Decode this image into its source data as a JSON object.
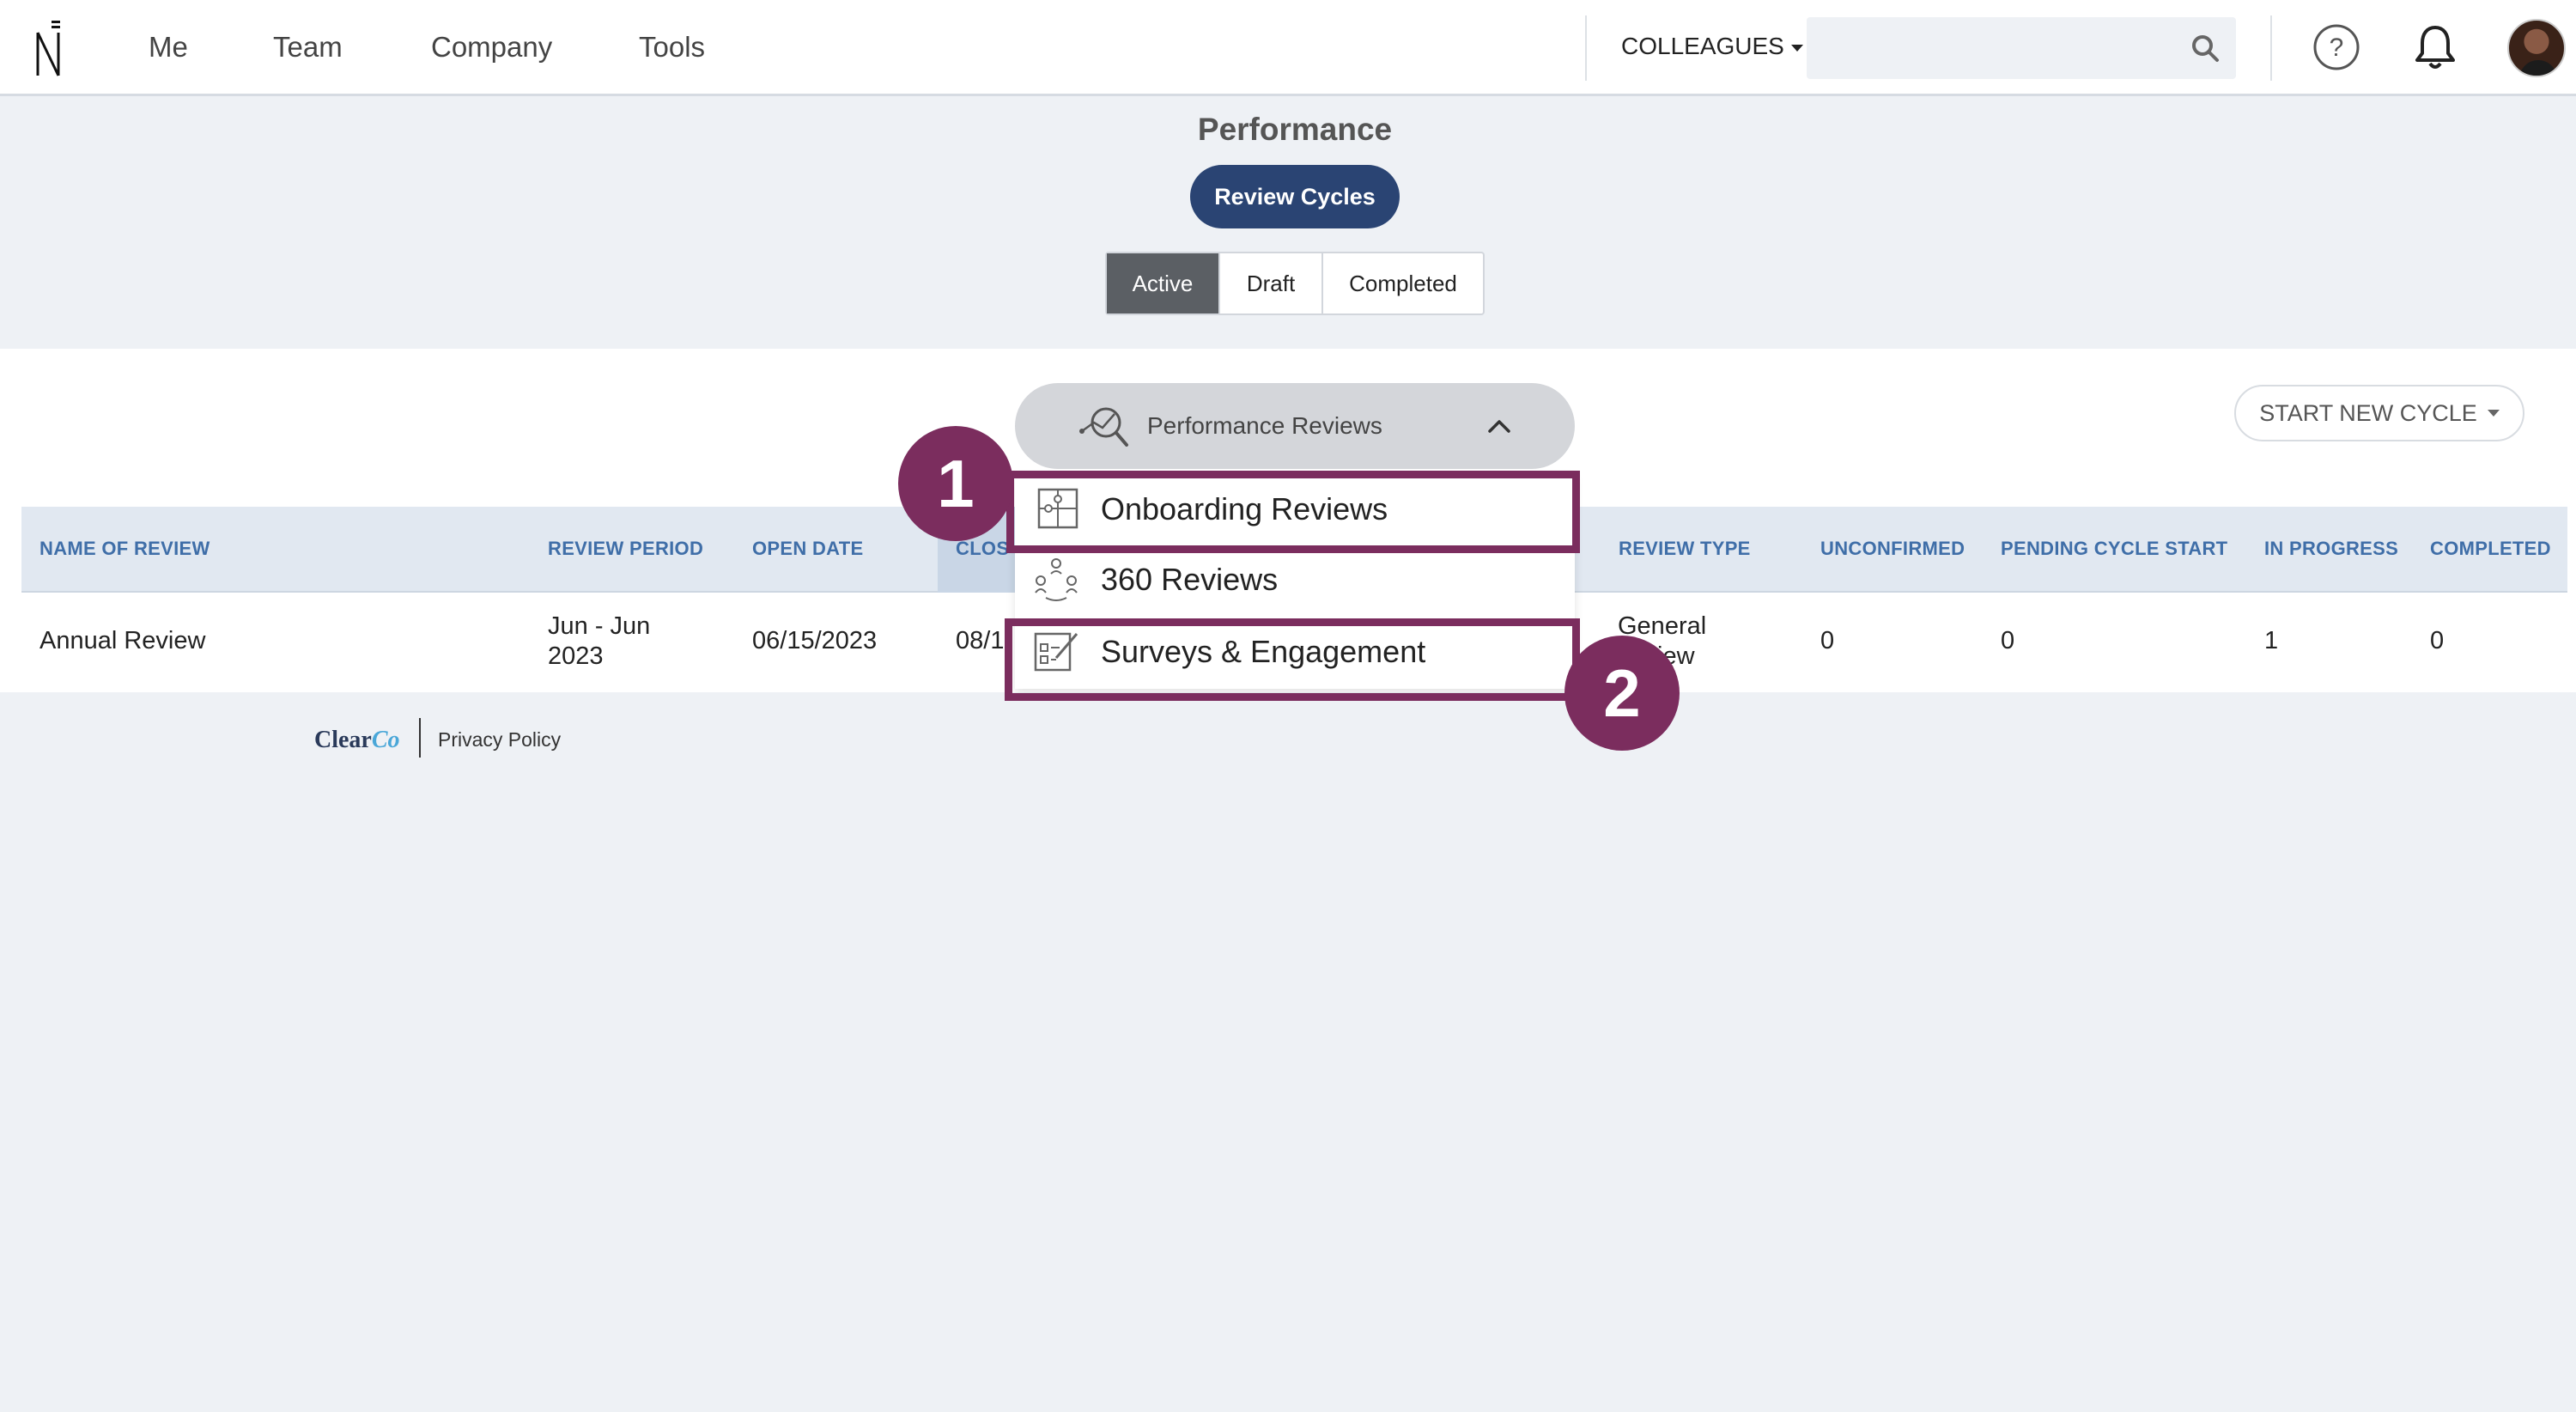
{
  "nav": {
    "links": [
      "Me",
      "Team",
      "Company",
      "Tools"
    ],
    "colleagues_label": "COLLEAGUES",
    "search_placeholder": "",
    "search_value": ""
  },
  "header": {
    "title": "Performance",
    "review_cycles_button": "Review Cycles",
    "tabs": [
      {
        "label": "Active",
        "active": true
      },
      {
        "label": "Draft",
        "active": false
      },
      {
        "label": "Completed",
        "active": false
      }
    ]
  },
  "toolbar": {
    "start_new_cycle": "START NEW CYCLE",
    "review_type_selected": "Performance Reviews"
  },
  "dropdown": {
    "items": [
      "Onboarding Reviews",
      "360 Reviews",
      "Surveys & Engagement"
    ],
    "callouts": [
      "1",
      "2"
    ]
  },
  "table": {
    "columns": [
      "NAME OF REVIEW",
      "REVIEW PERIOD",
      "OPEN DATE",
      "CLOS",
      "REVIEW TYPE",
      "UNCONFIRMED",
      "PENDING CYCLE START",
      "IN PROGRESS",
      "COMPLETED"
    ],
    "rows": [
      {
        "name": "Annual Review",
        "period_line1": "Jun - Jun",
        "period_line2": "2023",
        "open_date": "06/15/2023",
        "close_date": "08/1",
        "type_line1": "General",
        "type_line2": "iew",
        "unconfirmed": "0",
        "pending": "0",
        "in_progress": "1",
        "completed": "0"
      }
    ]
  },
  "footer": {
    "logo_part1": "Clear",
    "logo_part2": "Co",
    "privacy": "Privacy Policy"
  },
  "colors": {
    "accent_navy": "#2a4473",
    "callout_purple": "#7b2d5e",
    "header_blue_text": "#3f6ea8"
  }
}
